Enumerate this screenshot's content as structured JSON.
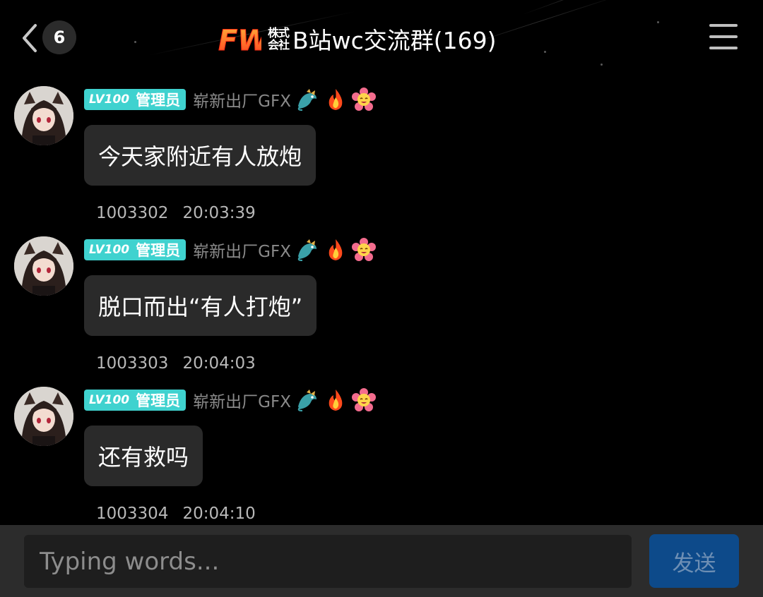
{
  "header": {
    "unread_count": "6",
    "logo_text": "FW",
    "corp_top": "株式",
    "corp_bottom": "会社",
    "group_name": "B站wc交流群(169)"
  },
  "messages": [
    {
      "level": "LV100",
      "role": "管理员",
      "nickname": "崭新出厂GFX",
      "text": "今天家附近有人放炮",
      "id": "1003302",
      "time": "20:03:39"
    },
    {
      "level": "LV100",
      "role": "管理员",
      "nickname": "崭新出厂GFX",
      "text": "脱口而出“有人打炮”",
      "id": "1003303",
      "time": "20:04:03"
    },
    {
      "level": "LV100",
      "role": "管理员",
      "nickname": "崭新出厂GFX",
      "text": "还有救吗",
      "id": "1003304",
      "time": "20:04:10"
    }
  ],
  "input": {
    "placeholder": "Typing words...",
    "send_label": "发送"
  },
  "colors": {
    "background": "#000000",
    "bubble": "#2a2a2a",
    "level_badge": "#3fd2cf",
    "send_button": "#0d4a8a",
    "input_bar": "#2c2c2c"
  },
  "icons": [
    "back-chevron-icon",
    "menu-icon",
    "dragon-icon",
    "fire-icon",
    "flower-icon"
  ]
}
